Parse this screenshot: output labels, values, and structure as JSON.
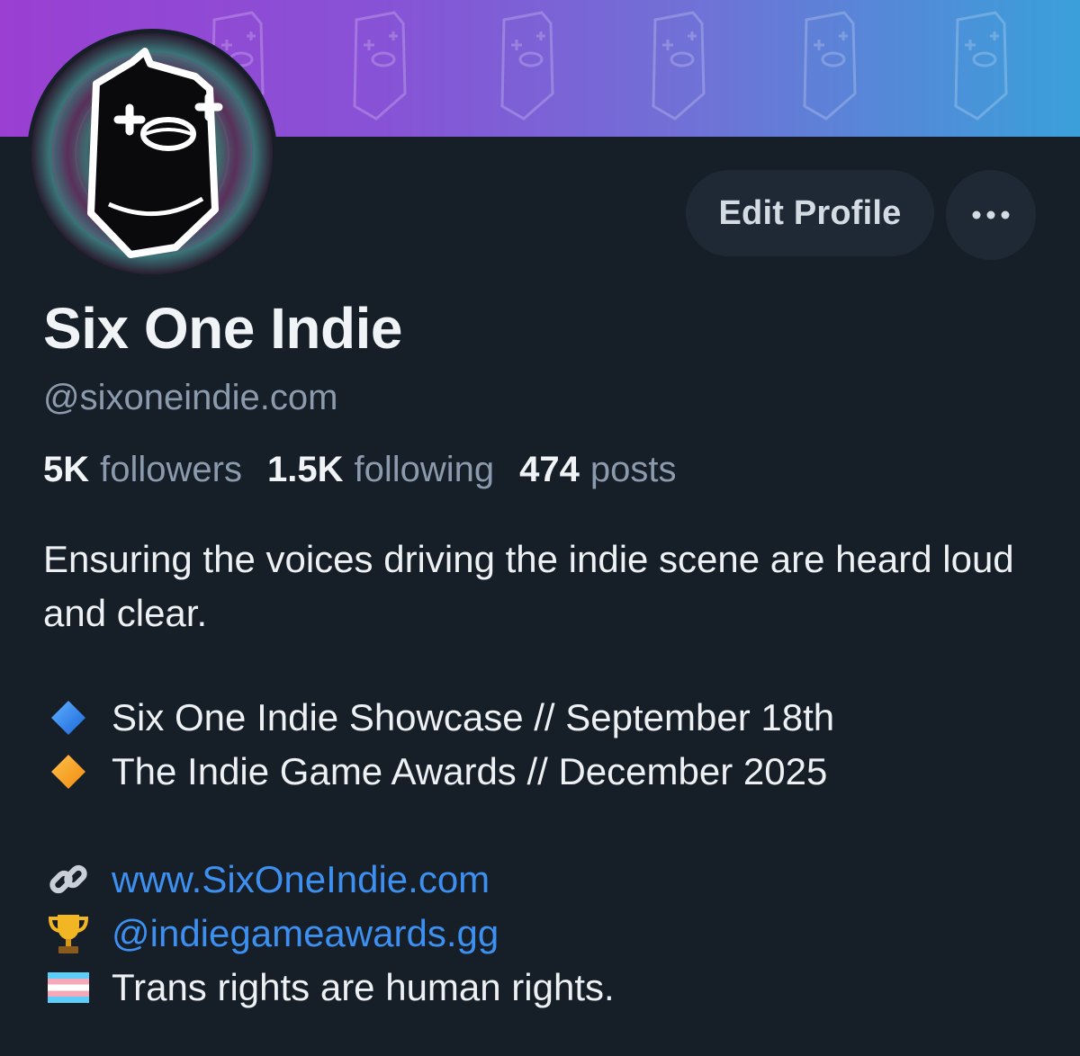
{
  "profile": {
    "display_name": "Six One Indie",
    "handle": "@sixoneindie.com",
    "edit_label": "Edit Profile"
  },
  "stats": {
    "followers_count": "5K",
    "followers_label": "followers",
    "following_count": "1.5K",
    "following_label": "following",
    "posts_count": "474",
    "posts_label": "posts"
  },
  "bio": {
    "intro": "Ensuring the voices driving the indie scene are heard loud and clear.",
    "lines": [
      {
        "icon": "blue-diamond-icon",
        "text": "Six One Indie Showcase // September 18th"
      },
      {
        "icon": "orange-diamond-icon",
        "text": "The Indie Game Awards // December 2025"
      },
      {
        "icon": "link-icon",
        "text": "www.SixOneIndie.com"
      },
      {
        "icon": "trophy-icon",
        "text": "@indiegameawards.gg"
      },
      {
        "icon": "trans-flag-icon",
        "text": "Trans rights are human rights."
      }
    ]
  },
  "colors": {
    "background": "#161e27",
    "button": "#1e2935",
    "link": "#3d8ff0",
    "muted": "#8b9bad",
    "banner_start": "#9a3fd2",
    "banner_end": "#3aa0da"
  }
}
